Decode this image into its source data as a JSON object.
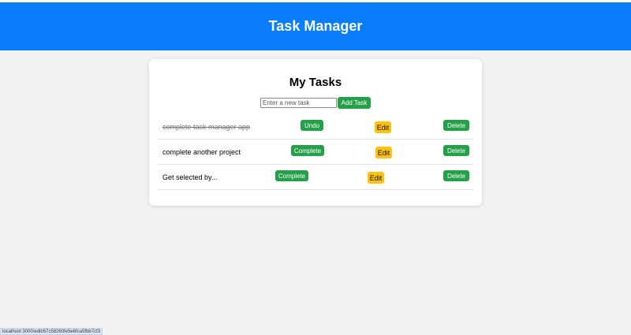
{
  "header": {
    "title": "Task Manager"
  },
  "card": {
    "title": "My Tasks",
    "input_placeholder": "Enter a new task",
    "add_label": "Add Task"
  },
  "tasks": [
    {
      "text": "complete task manager app",
      "completed": true,
      "toggle_label": "Undo",
      "edit_label": "Edit",
      "delete_label": "Delete"
    },
    {
      "text": "complete another project",
      "completed": false,
      "toggle_label": "Complete",
      "edit_label": "Edit",
      "delete_label": "Delete"
    },
    {
      "text": "Get selected by...",
      "completed": false,
      "toggle_label": "Complete",
      "edit_label": "Edit",
      "delete_label": "Delete"
    }
  ],
  "status_bar": {
    "url": "localhost:3000/edit/67c58260fe5e6fca5fbb7cf3"
  },
  "colors": {
    "header": "#0a7dfc",
    "success": "#25a048",
    "warning": "#ffc20e",
    "background": "#f2f2f2"
  }
}
